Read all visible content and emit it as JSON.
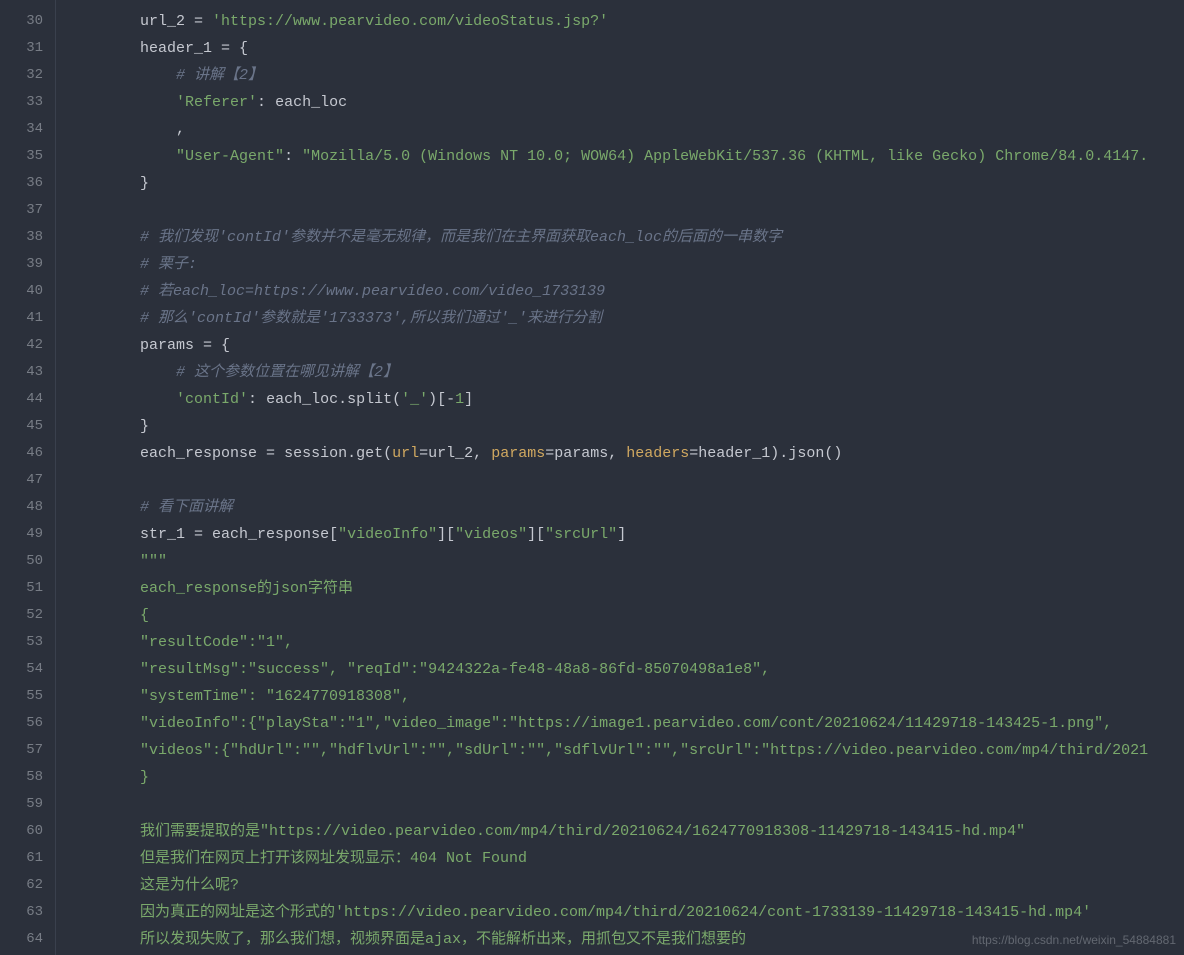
{
  "line_start": 30,
  "line_end": 64,
  "code": {
    "l30": {
      "indent": "        ",
      "tokens": [
        {
          "t": "url_2",
          "c": "ident"
        },
        {
          "t": " = ",
          "c": "op"
        },
        {
          "t": "'https://www.pearvideo.com/videoStatus.jsp?'",
          "c": "str"
        }
      ]
    },
    "l31": {
      "indent": "        ",
      "tokens": [
        {
          "t": "header_1",
          "c": "ident"
        },
        {
          "t": " = {",
          "c": "op"
        }
      ]
    },
    "l32": {
      "indent": "            ",
      "tokens": [
        {
          "t": "# 讲解【2】",
          "c": "cmt"
        }
      ]
    },
    "l33": {
      "indent": "            ",
      "tokens": [
        {
          "t": "'Referer'",
          "c": "str"
        },
        {
          "t": ": ",
          "c": "op"
        },
        {
          "t": "each_loc",
          "c": "ident"
        }
      ]
    },
    "l34": {
      "indent": "            ",
      "tokens": [
        {
          "t": ",",
          "c": "op"
        }
      ]
    },
    "l35": {
      "indent": "            ",
      "tokens": [
        {
          "t": "\"User-Agent\"",
          "c": "str"
        },
        {
          "t": ": ",
          "c": "op"
        },
        {
          "t": "\"Mozilla/5.0 (Windows NT 10.0; WOW64) AppleWebKit/537.36 (KHTML, like Gecko) Chrome/84.0.4147.",
          "c": "str"
        }
      ]
    },
    "l36": {
      "indent": "        ",
      "tokens": [
        {
          "t": "}",
          "c": "op"
        }
      ]
    },
    "l37": {
      "indent": "",
      "tokens": []
    },
    "l38": {
      "indent": "        ",
      "tokens": [
        {
          "t": "# 我们发现'contId'参数并不是毫无规律，而是我们在主界面获取each_loc的后面的一串数字",
          "c": "cmt"
        }
      ]
    },
    "l39": {
      "indent": "        ",
      "tokens": [
        {
          "t": "# 栗子:",
          "c": "cmt"
        }
      ]
    },
    "l40": {
      "indent": "        ",
      "tokens": [
        {
          "t": "# 若each_loc=https://www.pearvideo.com/video_1733139",
          "c": "cmt"
        }
      ]
    },
    "l41": {
      "indent": "        ",
      "tokens": [
        {
          "t": "# 那么'contId'参数就是'1733373',所以我们通过'_'来进行分割",
          "c": "cmt"
        }
      ]
    },
    "l42": {
      "indent": "        ",
      "tokens": [
        {
          "t": "params",
          "c": "ident"
        },
        {
          "t": " = {",
          "c": "op"
        }
      ]
    },
    "l43": {
      "indent": "            ",
      "tokens": [
        {
          "t": "# 这个参数位置在哪见讲解【2】",
          "c": "cmt"
        }
      ]
    },
    "l44": {
      "indent": "            ",
      "tokens": [
        {
          "t": "'contId'",
          "c": "str"
        },
        {
          "t": ": ",
          "c": "op"
        },
        {
          "t": "each_loc",
          "c": "ident"
        },
        {
          "t": ".",
          "c": "op"
        },
        {
          "t": "split",
          "c": "ident"
        },
        {
          "t": "(",
          "c": "op"
        },
        {
          "t": "'_'",
          "c": "str"
        },
        {
          "t": ")[-",
          "c": "op"
        },
        {
          "t": "1",
          "c": "num"
        },
        {
          "t": "]",
          "c": "op"
        }
      ]
    },
    "l45": {
      "indent": "        ",
      "tokens": [
        {
          "t": "}",
          "c": "op"
        }
      ]
    },
    "l46": {
      "indent": "        ",
      "tokens": [
        {
          "t": "each_response",
          "c": "ident"
        },
        {
          "t": " = ",
          "c": "op"
        },
        {
          "t": "session",
          "c": "ident"
        },
        {
          "t": ".",
          "c": "op"
        },
        {
          "t": "get",
          "c": "ident"
        },
        {
          "t": "(",
          "c": "op"
        },
        {
          "t": "url",
          "c": "call"
        },
        {
          "t": "=",
          "c": "op"
        },
        {
          "t": "url_2",
          "c": "ident"
        },
        {
          "t": ", ",
          "c": "op"
        },
        {
          "t": "params",
          "c": "call"
        },
        {
          "t": "=",
          "c": "op"
        },
        {
          "t": "params",
          "c": "ident"
        },
        {
          "t": ", ",
          "c": "op"
        },
        {
          "t": "headers",
          "c": "call"
        },
        {
          "t": "=",
          "c": "op"
        },
        {
          "t": "header_1",
          "c": "ident"
        },
        {
          "t": ").",
          "c": "op"
        },
        {
          "t": "json",
          "c": "ident"
        },
        {
          "t": "()",
          "c": "op"
        }
      ]
    },
    "l47": {
      "indent": "",
      "tokens": []
    },
    "l48": {
      "indent": "        ",
      "tokens": [
        {
          "t": "# 看下面讲解",
          "c": "cmt"
        }
      ]
    },
    "l49": {
      "indent": "        ",
      "tokens": [
        {
          "t": "str_1",
          "c": "ident"
        },
        {
          "t": " = ",
          "c": "op"
        },
        {
          "t": "each_response",
          "c": "ident"
        },
        {
          "t": "[",
          "c": "op"
        },
        {
          "t": "\"videoInfo\"",
          "c": "str"
        },
        {
          "t": "][",
          "c": "op"
        },
        {
          "t": "\"videos\"",
          "c": "str"
        },
        {
          "t": "][",
          "c": "op"
        },
        {
          "t": "\"srcUrl\"",
          "c": "str"
        },
        {
          "t": "]",
          "c": "op"
        }
      ]
    },
    "l50": {
      "indent": "        ",
      "tokens": [
        {
          "t": "\"\"\"",
          "c": "str"
        }
      ]
    },
    "l51": {
      "indent": "        ",
      "tokens": [
        {
          "t": "each_response的json字符串",
          "c": "str"
        }
      ]
    },
    "l52": {
      "indent": "        ",
      "tokens": [
        {
          "t": "{",
          "c": "str"
        }
      ]
    },
    "l53": {
      "indent": "        ",
      "tokens": [
        {
          "t": "\"resultCode\":\"1\",",
          "c": "str"
        }
      ]
    },
    "l54": {
      "indent": "        ",
      "tokens": [
        {
          "t": "\"resultMsg\":\"success\", \"reqId\":\"9424322a-fe48-48a8-86fd-85070498a1e8\",",
          "c": "str"
        }
      ]
    },
    "l55": {
      "indent": "        ",
      "tokens": [
        {
          "t": "\"systemTime\": \"1624770918308\",",
          "c": "str"
        }
      ]
    },
    "l56": {
      "indent": "        ",
      "tokens": [
        {
          "t": "\"videoInfo\":{\"playSta\":\"1\",\"video_image\":\"https://image1.pearvideo.com/cont/20210624/11429718-143425-1.png\",",
          "c": "str"
        }
      ]
    },
    "l57": {
      "indent": "        ",
      "tokens": [
        {
          "t": "\"videos\":{\"hdUrl\":\"\",\"hdflvUrl\":\"\",\"sdUrl\":\"\",\"sdflvUrl\":\"\",\"srcUrl\":\"https://video.pearvideo.com/mp4/third/2021",
          "c": "str"
        }
      ]
    },
    "l58": {
      "indent": "        ",
      "tokens": [
        {
          "t": "}",
          "c": "str"
        }
      ]
    },
    "l59": {
      "indent": "",
      "tokens": []
    },
    "l60": {
      "indent": "        ",
      "tokens": [
        {
          "t": "我们需要提取的是\"https://video.pearvideo.com/mp4/third/20210624/1624770918308-11429718-143415-hd.mp4\"",
          "c": "str"
        }
      ]
    },
    "l61": {
      "indent": "        ",
      "tokens": [
        {
          "t": "但是我们在网页上打开该网址发现显示：404 Not Found",
          "c": "str"
        }
      ]
    },
    "l62": {
      "indent": "        ",
      "tokens": [
        {
          "t": "这是为什么呢?",
          "c": "str"
        }
      ]
    },
    "l63": {
      "indent": "        ",
      "tokens": [
        {
          "t": "因为真正的网址是这个形式的'https://video.pearvideo.com/mp4/third/20210624/cont-1733139-11429718-143415-hd.mp4'",
          "c": "str"
        }
      ]
    },
    "l64": {
      "indent": "        ",
      "tokens": [
        {
          "t": "所以发现失败了，那么我们想，视频界面是ajax，不能解析出来，用抓包又不是我们想要的",
          "c": "str"
        }
      ]
    }
  },
  "watermark": "https://blog.csdn.net/weixin_54884881"
}
